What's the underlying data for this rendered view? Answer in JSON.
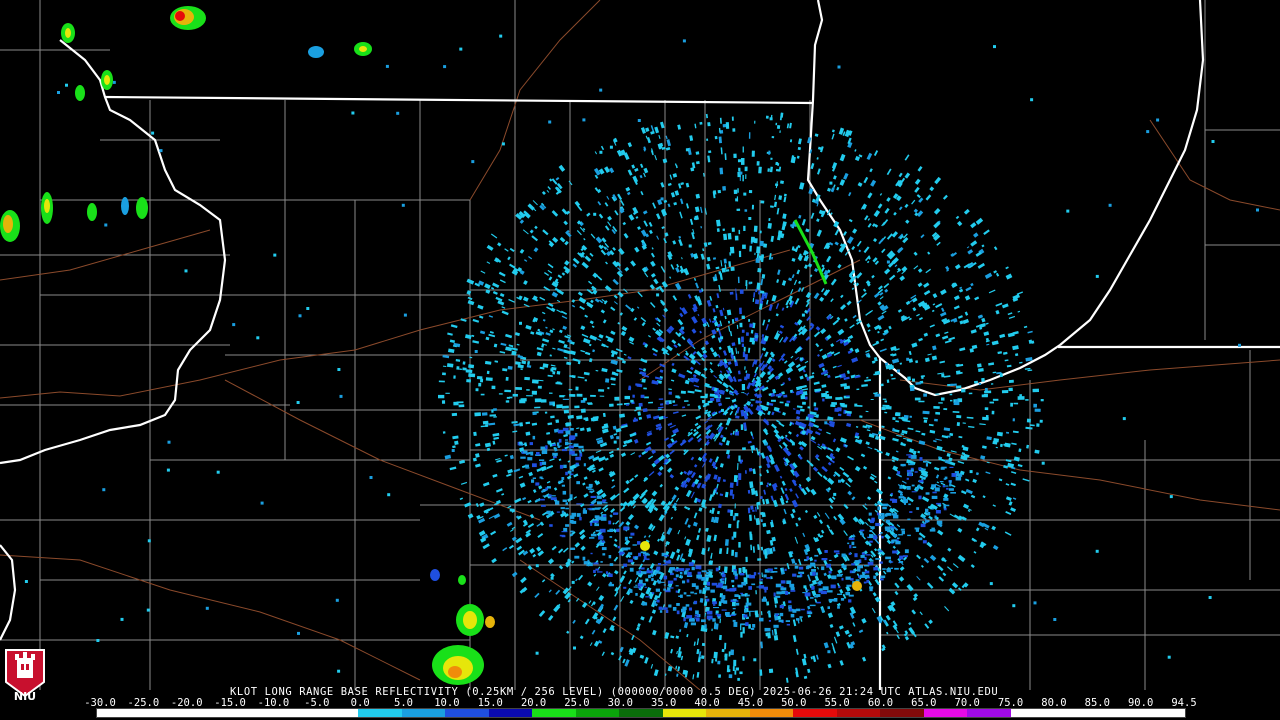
{
  "product_line": "KLOT LONG RANGE BASE REFLECTIVITY (0.25KM / 256 LEVEL) (000000/0000 0.5 DEG) 2025-06-26 21:24 UTC  ATLAS.NIU.EDU",
  "logo": {
    "name": "niu-logo",
    "text": "NIU"
  },
  "colorbar": {
    "labels": [
      "-30.0",
      "-25.0",
      "-20.0",
      "-15.0",
      "-10.0",
      "-5.0",
      "0.0",
      "5.0",
      "10.0",
      "15.0",
      "20.0",
      "25.0",
      "30.0",
      "35.0",
      "40.0",
      "45.0",
      "50.0",
      "55.0",
      "60.0",
      "65.0",
      "70.0",
      "75.0",
      "80.0",
      "85.0",
      "90.0",
      "94.5"
    ],
    "colors": [
      "#ffffff",
      "#ffffff",
      "#ffffff",
      "#ffffff",
      "#ffffff",
      "#ffffff",
      "#22ccee",
      "#1a9fe0",
      "#1f4fe0",
      "#0a0ab0",
      "#19e019",
      "#0aa50a",
      "#0a6e0a",
      "#e6e60a",
      "#e6b40a",
      "#f08c0a",
      "#e60a0a",
      "#b40a0a",
      "#820a0a",
      "#e60ae6",
      "#a00ae6",
      "#ffffff",
      "#ffffff",
      "#ffffff",
      "#ffffff"
    ]
  },
  "colors": {
    "state_border": "#ffffff",
    "county_border": "#8a8a8a",
    "highway": "#8b4a2b",
    "background": "#000000"
  },
  "radar": {
    "site": "KLOT",
    "echo_colors": [
      "#22ccee",
      "#1a9fe0",
      "#1f4fe0",
      "#0a0ab0",
      "#19e019",
      "#e6e60a",
      "#f08c0a",
      "#e60a0a"
    ]
  }
}
